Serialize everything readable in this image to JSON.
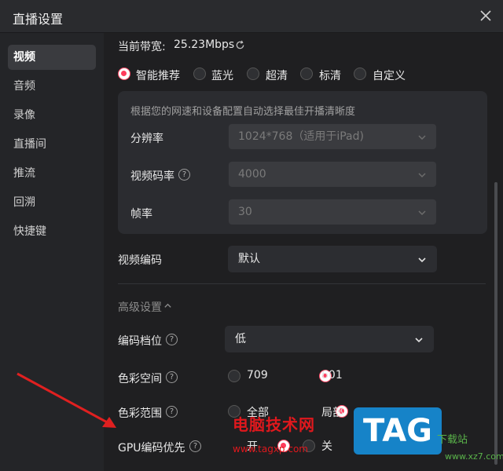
{
  "window": {
    "title": "直播设置"
  },
  "sidebar": {
    "items": [
      {
        "label": "视频",
        "active": true
      },
      {
        "label": "音频"
      },
      {
        "label": "录像"
      },
      {
        "label": "直播间"
      },
      {
        "label": "推流"
      },
      {
        "label": "回溯"
      },
      {
        "label": "快捷键"
      }
    ]
  },
  "video": {
    "bandwidth_label": "当前带宽:",
    "bandwidth_value": "25.23Mbps",
    "quality_options": [
      {
        "label": "智能推荐",
        "selected": true
      },
      {
        "label": "蓝光"
      },
      {
        "label": "超清"
      },
      {
        "label": "标清"
      },
      {
        "label": "自定义"
      }
    ],
    "panel": {
      "hint": "根据您的网速和设备配置自动选择最佳开播清晰度",
      "resolution_label": "分辨率",
      "resolution_value": "1024*768（适用于iPad)",
      "bitrate_label": "视频码率",
      "bitrate_value": "4000",
      "fps_label": "帧率",
      "fps_value": "30"
    },
    "encoder_label": "视频编码",
    "encoder_value": "默认",
    "advanced_label": "高级设置",
    "encode_level_label": "编码档位",
    "encode_level_value": "低",
    "color_space_label": "色彩空间",
    "color_space_options": [
      {
        "label": "709"
      },
      {
        "label": "601",
        "selected": true
      }
    ],
    "color_range_label": "色彩范围",
    "color_range_options": [
      {
        "label": "全部"
      },
      {
        "label": "局部",
        "selected": true
      }
    ],
    "gpu_label": "GPU编码优先",
    "gpu_options": [
      {
        "label": "开",
        "selected": true
      },
      {
        "label": "关"
      }
    ]
  },
  "watermark": {
    "cn": "电脑技术网",
    "tag": "TAG",
    "url": "www.tagxp.com",
    "site": "下载站",
    "site2": "www.xz7.com"
  },
  "colors": {
    "accent": "#ff3b5c",
    "annotation_arrow": "#e02020",
    "watermark_blue": "#1683c8"
  }
}
